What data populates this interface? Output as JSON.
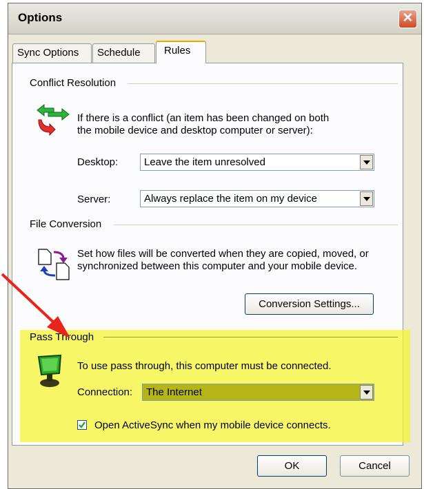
{
  "window": {
    "title": "Options"
  },
  "tabs": [
    {
      "label": "Sync Options"
    },
    {
      "label": "Schedule"
    },
    {
      "label": "Rules"
    }
  ],
  "conflict": {
    "group_label": "Conflict Resolution",
    "description": "If there is a conflict (an item has been changed on both the mobile device and desktop computer or server):",
    "desktop_label": "Desktop:",
    "desktop_value": "Leave the item unresolved",
    "server_label": "Server:",
    "server_value": "Always replace the item on my device"
  },
  "file_conversion": {
    "group_label": "File Conversion",
    "description": "Set how files will be converted when they are copied, moved, or synchronized between this computer and your mobile device.",
    "settings_button": "Conversion Settings..."
  },
  "pass_through": {
    "group_label": "Pass Through",
    "description": "To use pass through, this computer must be connected.",
    "connection_label": "Connection:",
    "connection_value": "The Internet",
    "checkbox_label": "Open ActiveSync when my mobile device connects.",
    "checkbox_checked": true
  },
  "buttons": {
    "ok": "OK",
    "cancel": "Cancel"
  },
  "colors": {
    "highlight": "#f5f52e",
    "annotation_arrow": "#e8251c"
  }
}
